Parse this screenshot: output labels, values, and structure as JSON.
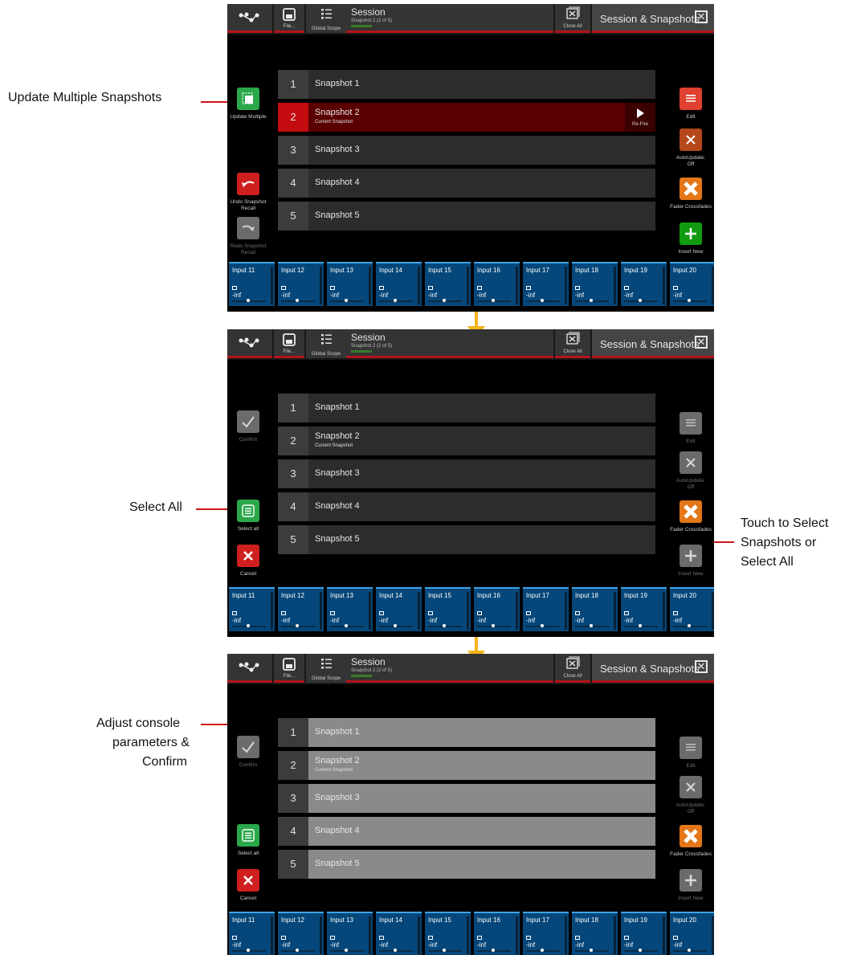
{
  "annotations": {
    "update_multiple": "Update Multiple Snapshots",
    "select_all": "Select All",
    "touch_select": [
      "Touch to Select",
      "Snapshots or",
      "Select All"
    ],
    "adjust_confirm": [
      "Adjust console",
      "parameters &",
      "Confirm"
    ]
  },
  "topbar": {
    "file_label": "File...",
    "global_scope_label": "Global Scope",
    "session_title": "Session",
    "session_sub": "Snapshot 2 (2 of 5)",
    "close_all_label": "Close All",
    "panel_title": "Session & Snapshots"
  },
  "snapshots": [
    {
      "num": "1",
      "name": "Snapshot 1"
    },
    {
      "num": "2",
      "name": "Snapshot 2",
      "sub": "Current Snapshot",
      "refire": "Re-Fire"
    },
    {
      "num": "3",
      "name": "Snapshot 3"
    },
    {
      "num": "4",
      "name": "Snapshot 4"
    },
    {
      "num": "5",
      "name": "Snapshot 5"
    }
  ],
  "left_buttons": {
    "update_multiple": "Update Multiple",
    "undo": [
      "Undo Snapshot",
      "Recall"
    ],
    "redo": [
      "Redo Snapshot",
      "Recall"
    ],
    "confirm": "Confirm",
    "select_all": "Select all",
    "cancel": "Cancel"
  },
  "right_buttons": {
    "edit": "Edit",
    "autoupdate": [
      "AutoUpdate:",
      "Off"
    ],
    "fader_crossfades": "Fader Crossfades",
    "insert_new": "Insert New"
  },
  "channels": [
    {
      "name": "Input 11",
      "value": "-inf"
    },
    {
      "name": "Input 12",
      "value": "-inf"
    },
    {
      "name": "Input 13",
      "value": "-inf"
    },
    {
      "name": "Input 14",
      "value": "-inf"
    },
    {
      "name": "Input 15",
      "value": "-inf"
    },
    {
      "name": "Input 16",
      "value": "-inf"
    },
    {
      "name": "Input 17",
      "value": "-inf"
    },
    {
      "name": "Input 18",
      "value": "-inf"
    },
    {
      "name": "Input 19",
      "value": "-inf"
    },
    {
      "name": "Input 20",
      "value": "-inf"
    }
  ],
  "colors": {
    "accent_red": "#b3141a",
    "arrow_yellow": "#f5b418",
    "channel_blue": "#05477a",
    "current_row": "#5a0000",
    "selected_row": "#8a8a8a"
  }
}
